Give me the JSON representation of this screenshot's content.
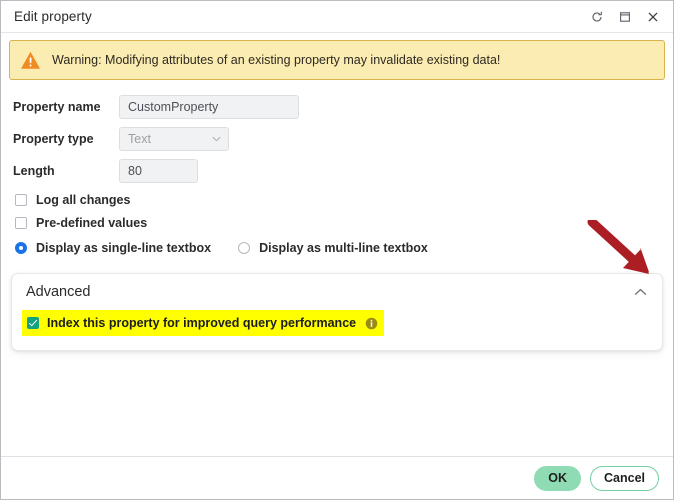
{
  "window": {
    "title": "Edit property",
    "controls": [
      {
        "name": "restore-icon",
        "label": "Restore"
      },
      {
        "name": "maximize-icon",
        "label": "Maximize"
      },
      {
        "name": "close-icon",
        "label": "Close"
      }
    ]
  },
  "banner": {
    "icon": "warning-triangle-icon",
    "text": "Warning: Modifying attributes of an existing property may invalidate existing data!",
    "background_color": "#fbecb2",
    "border_color": "#d8b24c"
  },
  "form": {
    "fields": [
      {
        "label": "Property name",
        "value": "CustomProperty",
        "type": "text"
      },
      {
        "label": "Property type",
        "value": "Text",
        "type": "select"
      },
      {
        "label": "Length",
        "value": "80",
        "type": "text"
      }
    ],
    "checkboxes": [
      {
        "label": "Log all changes",
        "checked": false
      },
      {
        "label": "Pre-defined values",
        "checked": false
      }
    ],
    "radios": [
      {
        "label": "Display as single-line textbox",
        "selected": true
      },
      {
        "label": "Display as multi-line textbox",
        "selected": false
      }
    ]
  },
  "advanced": {
    "title": "Advanced",
    "toggle_icon": "chevron-up-icon",
    "option": {
      "label": "Index this property for improved query performance",
      "checked": true,
      "highlight_color": "#ffff00",
      "checkbox_color": "#12a480",
      "info_icon": "info-icon"
    }
  },
  "annotation": {
    "name": "arrow-pointer",
    "color": "#ab1f24",
    "points_to": "advanced-collapse-toggle"
  },
  "footer": {
    "ok_label": "OK",
    "cancel_label": "Cancel",
    "ok_color": "#8fdcb4",
    "cancel_border_color": "#76cfa1"
  }
}
